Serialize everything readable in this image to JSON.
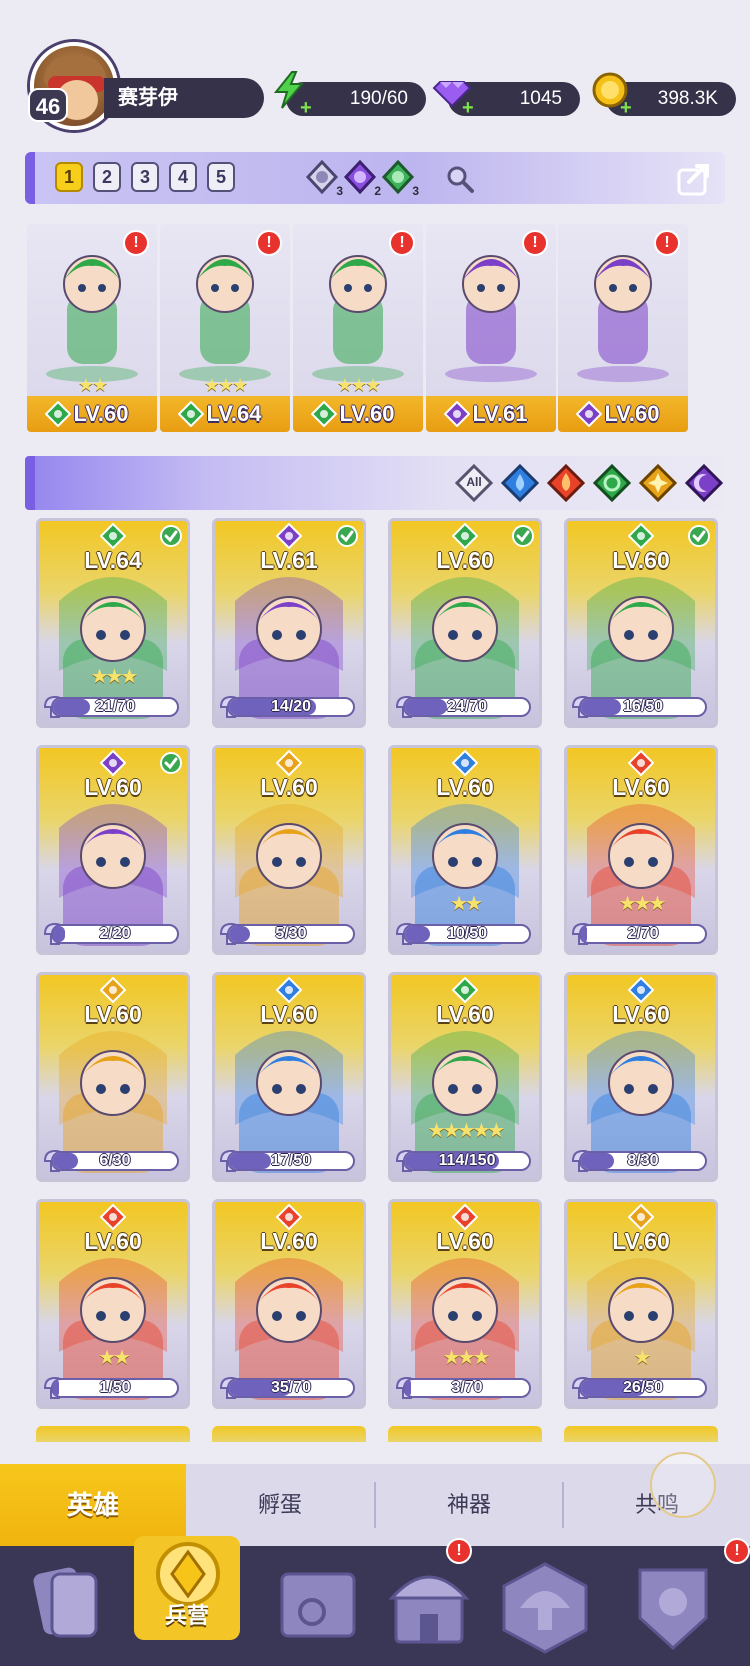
{
  "player": {
    "level": "46",
    "name": "赛芽伊"
  },
  "resources": {
    "energy": "190/60",
    "gems": "1045",
    "coins": "398.3K"
  },
  "team_tabs": [
    "1",
    "2",
    "3",
    "4",
    "5"
  ],
  "active_team_tab": "1",
  "crystals": [
    {
      "icon": "white-crystal-icon",
      "count": "3",
      "color": "#b8b6d8"
    },
    {
      "icon": "purple-crystal-icon",
      "count": "2",
      "color": "#8b4fe0"
    },
    {
      "icon": "green-crystal-icon",
      "count": "3",
      "color": "#3cb35a"
    }
  ],
  "team": [
    {
      "level": "LV.60",
      "stars": "★★",
      "element": "nature",
      "alert": "!"
    },
    {
      "level": "LV.64",
      "stars": "★★★",
      "element": "nature",
      "alert": "!"
    },
    {
      "level": "LV.60",
      "stars": "★★★",
      "element": "nature",
      "alert": "!"
    },
    {
      "level": "LV.61",
      "stars": "",
      "element": "dark",
      "alert": "!"
    },
    {
      "level": "LV.60",
      "stars": "",
      "element": "dark",
      "alert": "!"
    }
  ],
  "filters": {
    "all_label": "All",
    "elements": [
      "water",
      "fire",
      "nature",
      "light",
      "dark"
    ]
  },
  "element_colors": {
    "nature": "#2fa84a",
    "dark": "#7b3fc8",
    "water": "#2e7fe0",
    "fire": "#e8432a",
    "light": "#e8a21a"
  },
  "heroes": [
    {
      "level": "LV.64",
      "element": "nature",
      "owned": true,
      "stars": "★★★",
      "shards": "21/70",
      "progress": 0.3
    },
    {
      "level": "LV.61",
      "element": "dark",
      "owned": true,
      "stars": "",
      "shards": "14/20",
      "progress": 0.7
    },
    {
      "level": "LV.60",
      "element": "nature",
      "owned": true,
      "stars": "",
      "shards": "24/70",
      "progress": 0.34
    },
    {
      "level": "LV.60",
      "element": "nature",
      "owned": true,
      "stars": "",
      "shards": "16/50",
      "progress": 0.32
    },
    {
      "level": "LV.60",
      "element": "dark",
      "owned": true,
      "stars": "",
      "shards": "2/20",
      "progress": 0.1
    },
    {
      "level": "LV.60",
      "element": "light",
      "owned": false,
      "stars": "",
      "shards": "5/30",
      "progress": 0.17
    },
    {
      "level": "LV.60",
      "element": "water",
      "owned": false,
      "stars": "★★",
      "shards": "10/50",
      "progress": 0.2
    },
    {
      "level": "LV.60",
      "element": "fire",
      "owned": false,
      "stars": "★★★",
      "shards": "2/70",
      "progress": 0.03
    },
    {
      "level": "LV.60",
      "element": "light",
      "owned": false,
      "stars": "",
      "shards": "6/30",
      "progress": 0.2
    },
    {
      "level": "LV.60",
      "element": "water",
      "owned": false,
      "stars": "",
      "shards": "17/50",
      "progress": 0.34
    },
    {
      "level": "LV.60",
      "element": "nature",
      "owned": false,
      "stars": "★★★★★",
      "shards": "114/150",
      "progress": 0.76
    },
    {
      "level": "LV.60",
      "element": "water",
      "owned": false,
      "stars": "",
      "shards": "8/30",
      "progress": 0.27
    },
    {
      "level": "LV.60",
      "element": "fire",
      "owned": false,
      "stars": "★★",
      "shards": "1/50",
      "progress": 0.02
    },
    {
      "level": "LV.60",
      "element": "fire",
      "owned": false,
      "stars": "",
      "shards": "35/70",
      "progress": 0.5
    },
    {
      "level": "LV.60",
      "element": "fire",
      "owned": false,
      "stars": "★★★",
      "shards": "3/70",
      "progress": 0.04
    },
    {
      "level": "LV.60",
      "element": "light",
      "owned": false,
      "stars": "★",
      "shards": "26/50",
      "progress": 0.52
    }
  ],
  "category_tabs": [
    "英雄",
    "孵蛋",
    "神器",
    "共鸣"
  ],
  "bottom_nav": {
    "active_label": "兵营",
    "items": [
      "cards-icon",
      "barracks-icon",
      "map-icon",
      "temple-icon",
      "mushroom-icon",
      "guild-icon"
    ],
    "alerts": "!"
  }
}
